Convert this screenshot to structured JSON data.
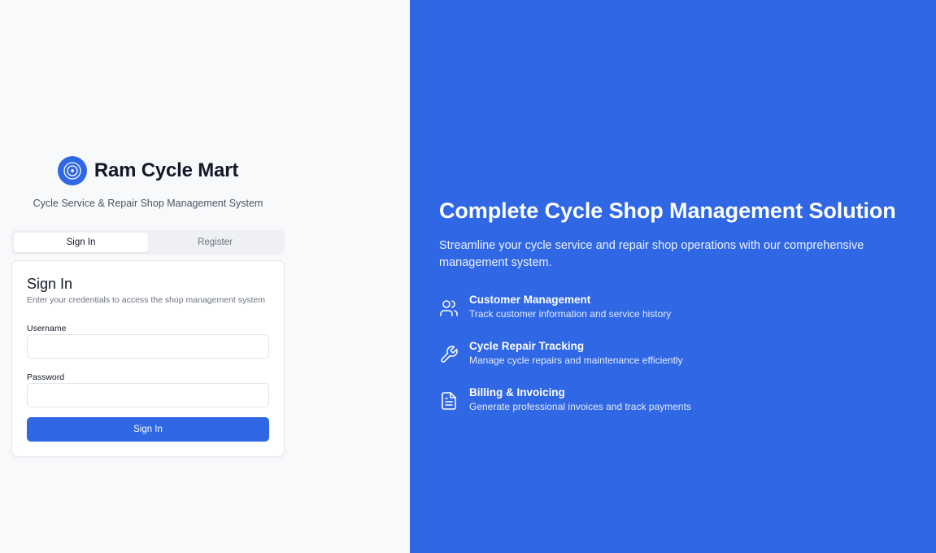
{
  "brand": {
    "title": "Ram Cycle Mart",
    "subtitle": "Cycle Service & Repair Shop Management System",
    "logo_icon": "cycle-wheel-icon",
    "accent_color": "#2f67e4"
  },
  "tabs": [
    {
      "label": "Sign In",
      "active": true
    },
    {
      "label": "Register",
      "active": false
    }
  ],
  "signin_card": {
    "title": "Sign In",
    "description": "Enter your credentials to access the shop management system",
    "username_label": "Username",
    "username_value": "",
    "password_label": "Password",
    "password_value": "",
    "submit_label": "Sign In"
  },
  "hero": {
    "title": "Complete Cycle Shop Management Solution",
    "description": "Streamline your cycle service and repair shop operations with our comprehensive management system.",
    "features": [
      {
        "icon": "users-icon",
        "title": "Customer Management",
        "description": "Track customer information and service history"
      },
      {
        "icon": "wrench-icon",
        "title": "Cycle Repair Tracking",
        "description": "Manage cycle repairs and maintenance efficiently"
      },
      {
        "icon": "file-text-icon",
        "title": "Billing & Invoicing",
        "description": "Generate professional invoices and track payments"
      }
    ]
  }
}
